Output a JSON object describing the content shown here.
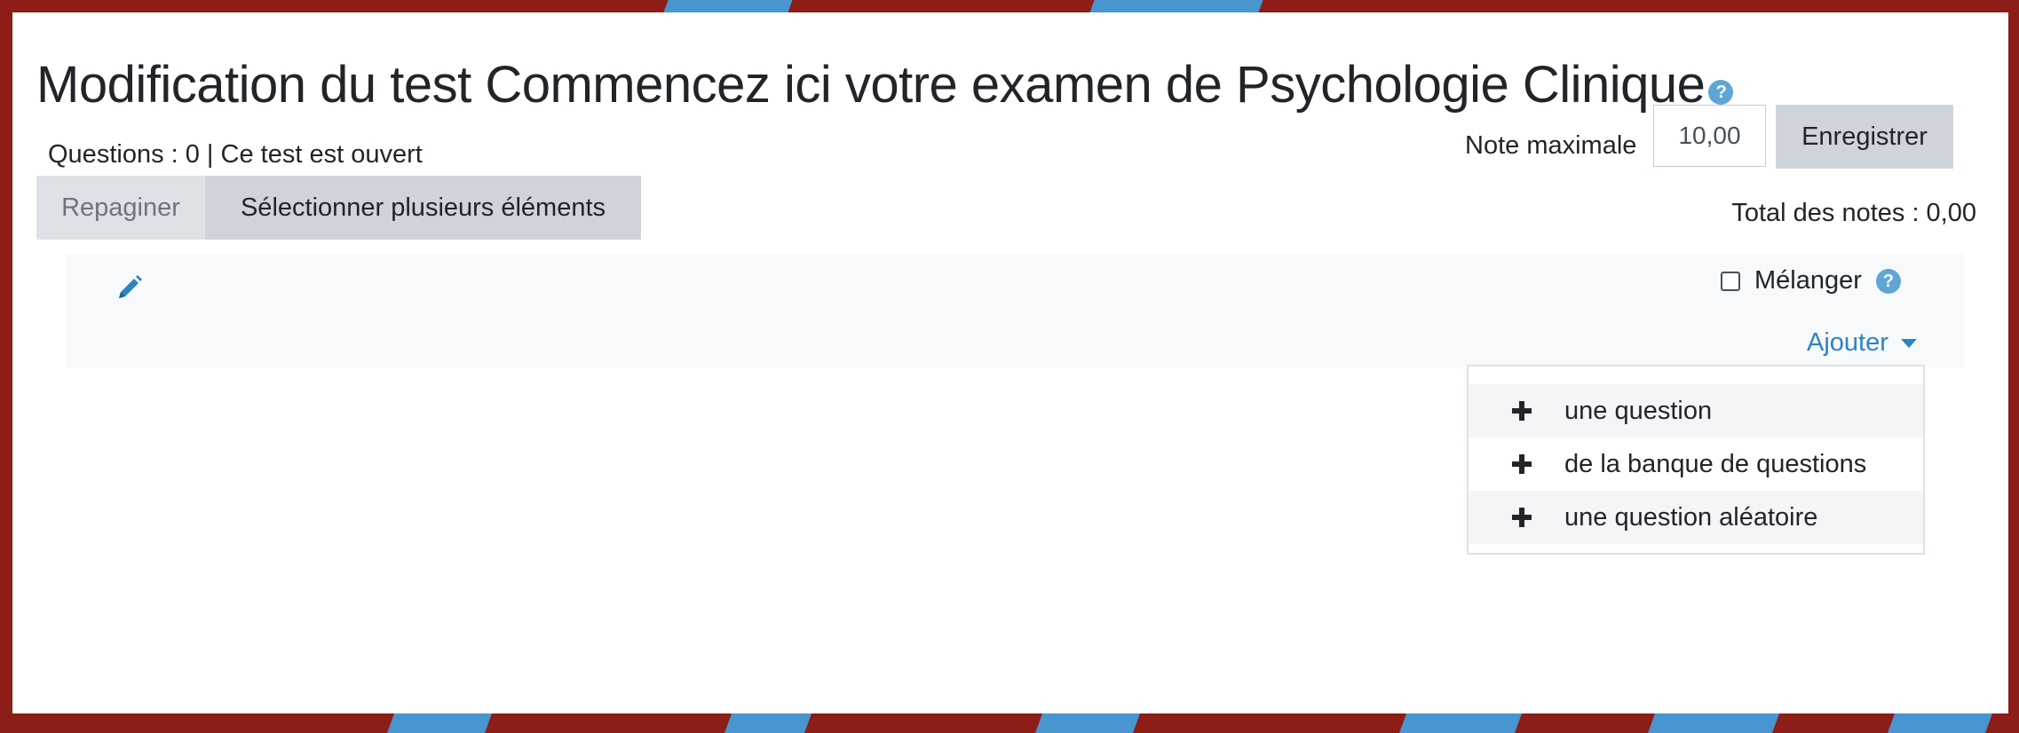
{
  "page": {
    "title": "Modification du test Commencez ici votre examen de Psychologie Clinique",
    "help_icon": "question-circle-icon",
    "status": "Questions : 0 | Ce test est ouvert"
  },
  "grading": {
    "max_label": "Note maximale",
    "max_value": "10,00",
    "save_label": "Enregistrer",
    "total": "Total des notes : 0,00"
  },
  "toolbar": {
    "repaginate_label": "Repaginer",
    "select_multiple_label": "Sélectionner plusieurs éléments"
  },
  "section": {
    "edit_icon": "pencil-icon",
    "shuffle_label": "Mélanger",
    "shuffle_checked": false,
    "add_label": "Ajouter"
  },
  "add_menu": {
    "items": [
      {
        "icon": "plus-icon",
        "label": "une question"
      },
      {
        "icon": "plus-icon",
        "label": "de la banque de questions"
      },
      {
        "icon": "plus-icon",
        "label": "une question aléatoire"
      }
    ]
  },
  "colors": {
    "accent": "#2f83c4",
    "help_icon": "#5fa6d6",
    "frame_red": "#8c1d17",
    "frame_blue": "#4895cf",
    "button_grey": "#ced4da"
  }
}
